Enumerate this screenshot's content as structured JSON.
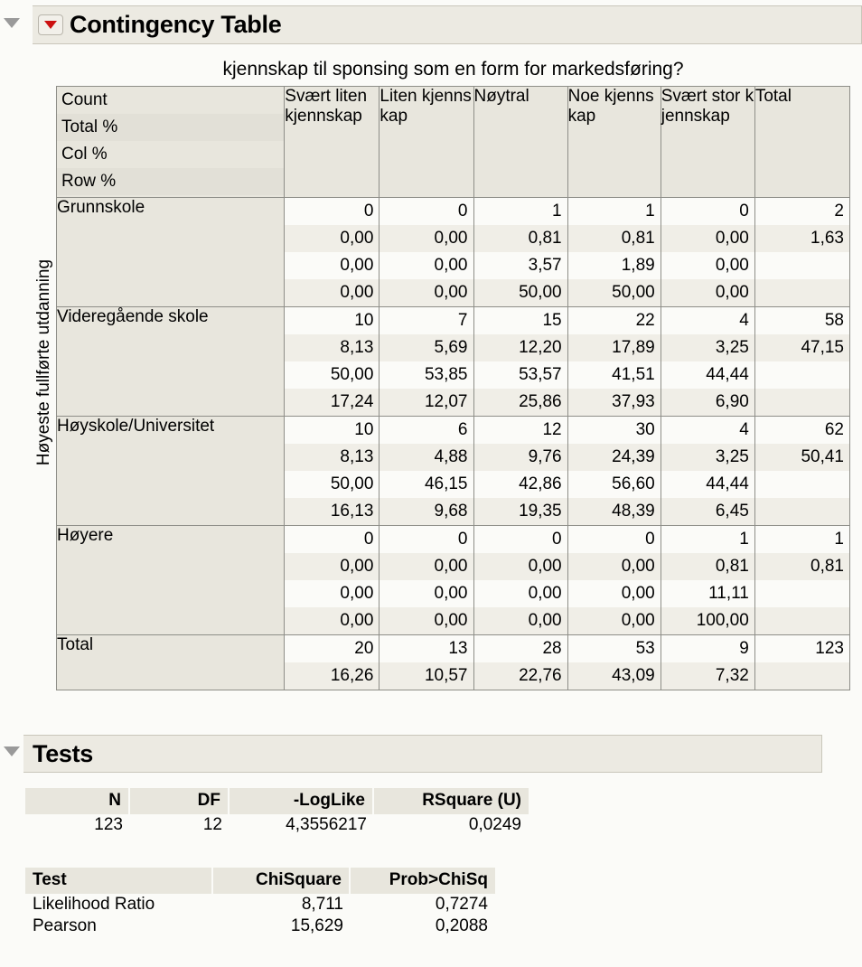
{
  "sections": {
    "contingency": {
      "title": "Contingency Table"
    },
    "tests": {
      "title": "Tests"
    }
  },
  "contingency": {
    "column_variable_title": "kjennskap til sponsing som en form for markedsføring?",
    "row_variable_title": "Høyeste fullførte utdanning",
    "stat_legend": [
      "Count",
      "Total %",
      "Col %",
      "Row %"
    ],
    "column_headers": [
      "Svært liten kjennskap",
      "Liten kjennskap",
      "Nøytral",
      "Noe kjennskap",
      "Svært stor kjennskap",
      "Total"
    ],
    "rows": [
      {
        "label": "Grunnskole",
        "cells": [
          [
            "0",
            "0,00",
            "0,00",
            "0,00"
          ],
          [
            "0",
            "0,00",
            "0,00",
            "0,00"
          ],
          [
            "1",
            "0,81",
            "3,57",
            "50,00"
          ],
          [
            "1",
            "0,81",
            "1,89",
            "50,00"
          ],
          [
            "0",
            "0,00",
            "0,00",
            "0,00"
          ],
          [
            "2",
            "1,63",
            "",
            ""
          ]
        ]
      },
      {
        "label": "Videregående skole",
        "cells": [
          [
            "10",
            "8,13",
            "50,00",
            "17,24"
          ],
          [
            "7",
            "5,69",
            "53,85",
            "12,07"
          ],
          [
            "15",
            "12,20",
            "53,57",
            "25,86"
          ],
          [
            "22",
            "17,89",
            "41,51",
            "37,93"
          ],
          [
            "4",
            "3,25",
            "44,44",
            "6,90"
          ],
          [
            "58",
            "47,15",
            "",
            ""
          ]
        ]
      },
      {
        "label": "Høyskole/Universitet",
        "cells": [
          [
            "10",
            "8,13",
            "50,00",
            "16,13"
          ],
          [
            "6",
            "4,88",
            "46,15",
            "9,68"
          ],
          [
            "12",
            "9,76",
            "42,86",
            "19,35"
          ],
          [
            "30",
            "24,39",
            "56,60",
            "48,39"
          ],
          [
            "4",
            "3,25",
            "44,44",
            "6,45"
          ],
          [
            "62",
            "50,41",
            "",
            ""
          ]
        ]
      },
      {
        "label": "Høyere",
        "cells": [
          [
            "0",
            "0,00",
            "0,00",
            "0,00"
          ],
          [
            "0",
            "0,00",
            "0,00",
            "0,00"
          ],
          [
            "0",
            "0,00",
            "0,00",
            "0,00"
          ],
          [
            "0",
            "0,00",
            "0,00",
            "0,00"
          ],
          [
            "1",
            "0,81",
            "11,11",
            "100,00"
          ],
          [
            "1",
            "0,81",
            "",
            ""
          ]
        ]
      }
    ],
    "total_row": {
      "label": "Total",
      "cells": [
        [
          "20",
          "16,26"
        ],
        [
          "13",
          "10,57"
        ],
        [
          "28",
          "22,76"
        ],
        [
          "53",
          "43,09"
        ],
        [
          "9",
          "7,32"
        ],
        [
          "123",
          ""
        ]
      ]
    }
  },
  "tests": {
    "summary": {
      "headers": [
        "N",
        "DF",
        "-LogLike",
        "RSquare (U)"
      ],
      "values": [
        "123",
        "12",
        "4,3556217",
        "0,0249"
      ]
    },
    "chisq": {
      "headers": [
        "Test",
        "ChiSquare",
        "Prob>ChiSq"
      ],
      "rows": [
        [
          "Likelihood Ratio",
          "8,711",
          "0,7274"
        ],
        [
          "Pearson",
          "15,629",
          "0,2088"
        ]
      ]
    }
  },
  "chart_data": {
    "type": "table",
    "title": "Contingency Table",
    "xlabel": "kjennskap til sponsing som en form for markedsføring?",
    "ylabel": "Høyeste fullførte utdanning",
    "statistics_shown": [
      "Count",
      "Total %",
      "Col %",
      "Row %"
    ],
    "categories": [
      "Svært liten kjennskap",
      "Liten kjennskap",
      "Nøytral",
      "Noe kjennskap",
      "Svært stor kjennskap"
    ],
    "row_categories": [
      "Grunnskole",
      "Videregående skole",
      "Høyskole/Universitet",
      "Høyere"
    ],
    "counts": [
      [
        0,
        0,
        1,
        1,
        0
      ],
      [
        10,
        7,
        15,
        22,
        4
      ],
      [
        10,
        6,
        12,
        30,
        4
      ],
      [
        0,
        0,
        0,
        0,
        1
      ]
    ],
    "row_totals": [
      2,
      58,
      62,
      1
    ],
    "column_totals": [
      20,
      13,
      28,
      53,
      9
    ],
    "grand_total": 123,
    "row_total_pct": [
      1.63,
      47.15,
      50.41,
      0.81
    ],
    "column_total_pct": [
      16.26,
      10.57,
      22.76,
      43.09,
      7.32
    ],
    "n": 123,
    "df": 12,
    "neg_loglike": 4.3556217,
    "rsquare_u": 0.0249,
    "likelihood_ratio_chisq": 8.711,
    "likelihood_ratio_p": 0.7274,
    "pearson_chisq": 15.629,
    "pearson_p": 0.2088
  }
}
